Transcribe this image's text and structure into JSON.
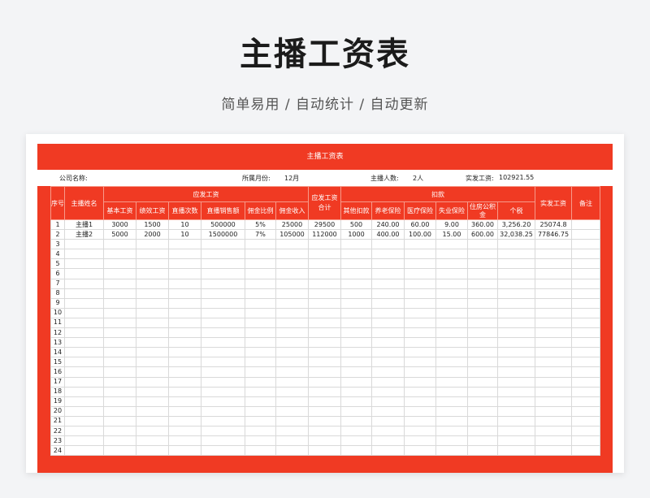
{
  "page": {
    "title": "主播工资表",
    "subtitle": "简单易用 / 自动统计 / 自动更新"
  },
  "sheet": {
    "title": "主播工资表",
    "info": {
      "company_label": "公司名称:",
      "month_label": "所属月份:",
      "month_value": "12月",
      "anchor_count_label": "主播人数:",
      "anchor_count_value": "2人",
      "actual_pay_label": "实发工资:",
      "actual_pay_value": "102921.55"
    },
    "headers": {
      "seq": "序号",
      "name": "主播姓名",
      "payable_group": "应发工资",
      "base_salary": "基本工资",
      "performance": "绩效工资",
      "live_count": "直播次数",
      "live_sales": "直播销售额",
      "commission_rate": "佣金比例",
      "commission_income": "佣金收入",
      "payable_total": "应发工资合计",
      "deduction_group": "扣款",
      "other_deduction": "其他扣款",
      "pension": "养老保险",
      "medical": "医疗保险",
      "unemployment": "失业保险",
      "housing_fund": "住房公积金",
      "tax": "个税",
      "actual_pay": "实发工资",
      "remark": "备注"
    },
    "rows": [
      {
        "seq": "1",
        "name": "主播1",
        "base": "3000",
        "perf": "1500",
        "count": "10",
        "sales": "500000",
        "rate": "5%",
        "comm": "25000",
        "total": "29500",
        "other": "500",
        "pension": "240.00",
        "medical": "60.00",
        "unemp": "9.00",
        "housing": "360.00",
        "tax": "3,256.20",
        "actual": "25074.8",
        "remark": ""
      },
      {
        "seq": "2",
        "name": "主播2",
        "base": "5000",
        "perf": "2000",
        "count": "10",
        "sales": "1500000",
        "rate": "7%",
        "comm": "105000",
        "total": "112000",
        "other": "1000",
        "pension": "400.00",
        "medical": "100.00",
        "unemp": "15.00",
        "housing": "600.00",
        "tax": "32,038.25",
        "actual": "77846.75",
        "remark": ""
      }
    ],
    "empty_row_numbers": [
      "3",
      "4",
      "5",
      "6",
      "7",
      "8",
      "9",
      "10",
      "11",
      "12",
      "13",
      "14",
      "15",
      "16",
      "17",
      "18",
      "19",
      "20",
      "21",
      "22",
      "23",
      "24"
    ]
  }
}
